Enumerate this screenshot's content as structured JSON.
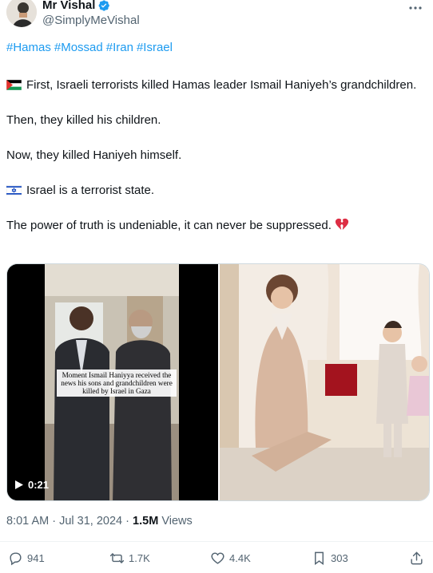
{
  "author": {
    "name": "Mr Vishal",
    "handle": "@SimplyMeVishal",
    "verified_icon": "verified-badge-icon"
  },
  "tweet": {
    "hashtags": [
      "#Hamas",
      "#Mossad",
      "#Iran",
      "#Israel"
    ],
    "line1": "First, Israeli terrorists killed Hamas leader Ismail Haniyeh’s grandchildren.",
    "line2": "Then, they killed his children.",
    "line3": "Now, they killed Haniyeh himself.",
    "line4": "Israel is a terrorist state.",
    "line5": "The power of truth is undeniable, it can never be suppressed.",
    "line5_emoji": "💔"
  },
  "media": {
    "video_caption": "Moment Ismail Haniyya received the news his sons and grandchildren were killed by Israel in Gaza",
    "video_duration": "0:21"
  },
  "meta": {
    "time": "8:01 AM",
    "separator": "·",
    "date": "Jul 31, 2024",
    "views_count": "1.5M",
    "views_label": "Views"
  },
  "actions": {
    "replies": "941",
    "reposts": "1.7K",
    "likes": "4.4K",
    "bookmarks": "303"
  },
  "colors": {
    "link": "#1d9bf0",
    "secondary_text": "#536471",
    "primary_text": "#0f1419"
  }
}
